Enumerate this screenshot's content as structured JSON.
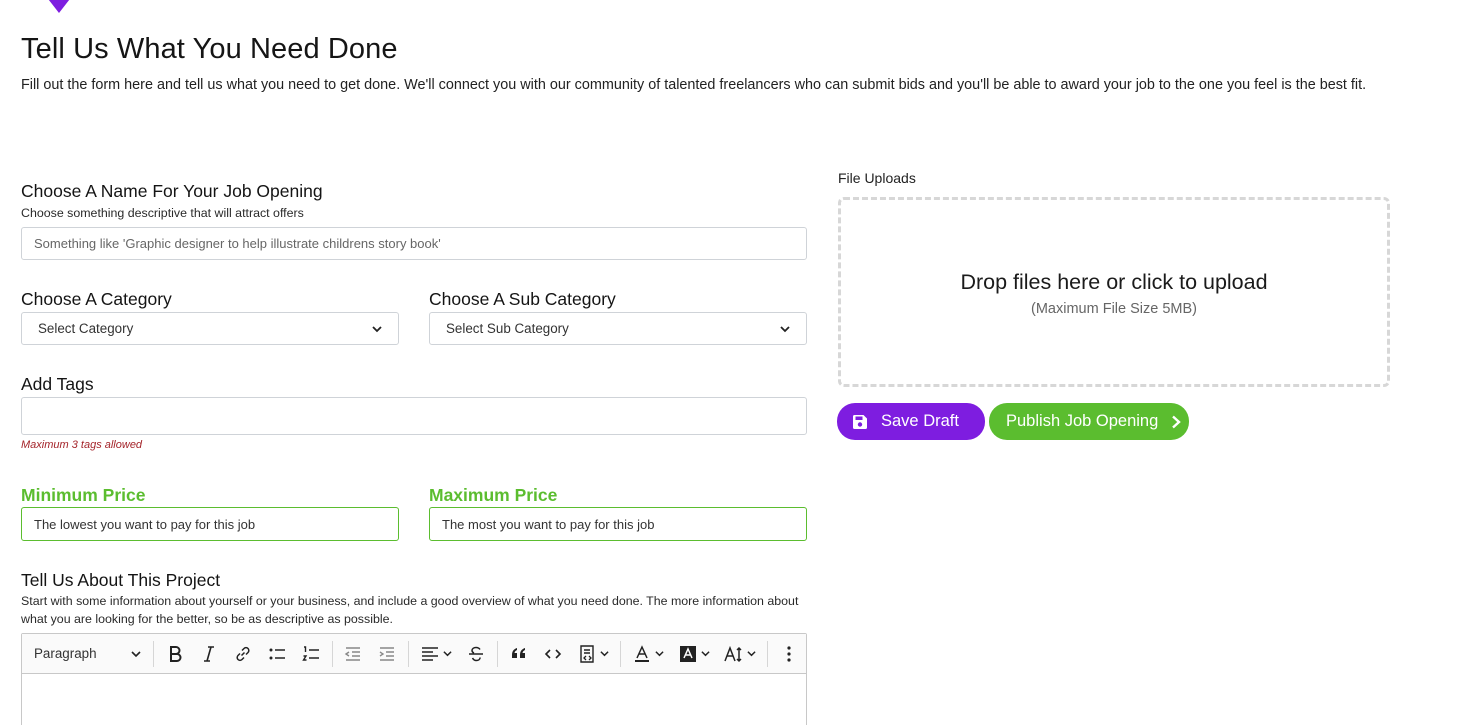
{
  "colors": {
    "brand_purple": "#7e1de0",
    "accent_green": "#5bbd2f",
    "error_red": "#a4242a"
  },
  "page": {
    "title": "Tell Us What You Need Done",
    "intro": "Fill out the form here and tell us what you need to get done. We'll connect you with our community of talented freelancers who can submit bids and you'll be able to award your job to the one you feel is the best fit."
  },
  "job_name": {
    "label": "Choose A Name For Your Job Opening",
    "hint": "Choose something descriptive that will attract offers",
    "placeholder": "Something like 'Graphic designer to help illustrate childrens story book'"
  },
  "category": {
    "label": "Choose A Category",
    "selected": "Select Category"
  },
  "sub_category": {
    "label": "Choose A Sub Category",
    "selected": "Select Sub Category"
  },
  "tags": {
    "label": "Add Tags",
    "hint": "Maximum 3 tags allowed"
  },
  "min_price": {
    "label": "Minimum Price",
    "placeholder": "The lowest you want to pay for this job"
  },
  "max_price": {
    "label": "Maximum Price",
    "placeholder": "The most you want to pay for this job"
  },
  "project": {
    "label": "Tell Us About This Project",
    "hint": "Start with some information about yourself or your business, and include a good overview of what you need done. The more information about what you are looking for the better, so be as descriptive as possible."
  },
  "editor": {
    "paragraph_style": "Paragraph",
    "tools": [
      "bold-icon",
      "italic-icon",
      "link-icon",
      "bulleted-list-icon",
      "numbered-list-icon",
      "outdent-icon",
      "indent-icon",
      "align-icon",
      "strikethrough-icon",
      "blockquote-icon",
      "code-icon",
      "code-block-icon",
      "font-color-icon",
      "font-background-icon",
      "font-size-icon",
      "more-options-icon"
    ]
  },
  "uploads": {
    "label": "File Uploads",
    "drop_text": "Drop files here or click to upload",
    "size_hint": "(Maximum File Size 5MB)"
  },
  "actions": {
    "save_label": "Save Draft",
    "publish_label": "Publish Job Opening"
  }
}
